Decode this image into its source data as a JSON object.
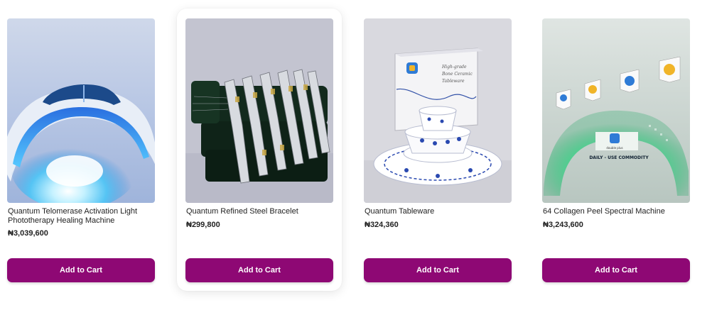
{
  "products": [
    {
      "title": "Quantum Telomerase Activation Light Phototherapy Healing Machine",
      "price": "₦3,039,600",
      "button": "Add to Cart"
    },
    {
      "title": "Quantum Refined Steel Bracelet",
      "price": "₦299,800",
      "button": "Add to Cart"
    },
    {
      "title": "Quantum Tableware",
      "price": "₦324,360",
      "button": "Add to Cart",
      "box_text": [
        "High-grade",
        "Bone Ceramic",
        "Tableware"
      ]
    },
    {
      "title": "64 Collagen Peel Spectral Machine",
      "price": "₦3,243,600",
      "button": "Add to Cart",
      "banner_text": "DAILY - USE COMMODITY",
      "brand_text": "double plus"
    }
  ],
  "colors": {
    "button": "#8e0874",
    "button_text": "#ffffff",
    "text": "#222222"
  }
}
